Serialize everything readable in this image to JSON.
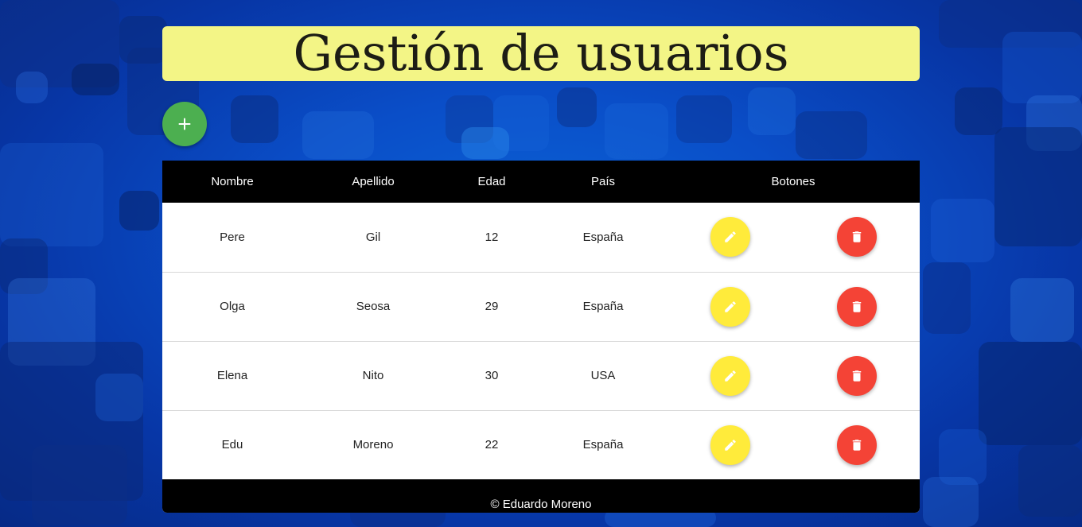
{
  "header": {
    "title": "Gestión de usuarios"
  },
  "toolbar": {
    "add_icon": "plus-icon"
  },
  "table": {
    "columns": [
      "Nombre",
      "Apellido",
      "Edad",
      "País",
      "Botones"
    ],
    "rows": [
      {
        "nombre": "Pere",
        "apellido": "Gil",
        "edad": "12",
        "pais": "España"
      },
      {
        "nombre": "Olga",
        "apellido": "Seosa",
        "edad": "29",
        "pais": "España"
      },
      {
        "nombre": "Elena",
        "apellido": "Nito",
        "edad": "30",
        "pais": "USA"
      },
      {
        "nombre": "Edu",
        "apellido": "Moreno",
        "edad": "22",
        "pais": "España"
      }
    ],
    "row_actions": {
      "edit_icon": "pencil-icon",
      "delete_icon": "trash-icon"
    }
  },
  "footer": {
    "text": "© Eduardo Moreno"
  },
  "colors": {
    "title_bg": "#f3f586",
    "add_button": "#4caf50",
    "edit_button": "#ffeb3b",
    "delete_button": "#f44336",
    "table_header_bg": "#000000",
    "background": "#0a4ec8"
  }
}
